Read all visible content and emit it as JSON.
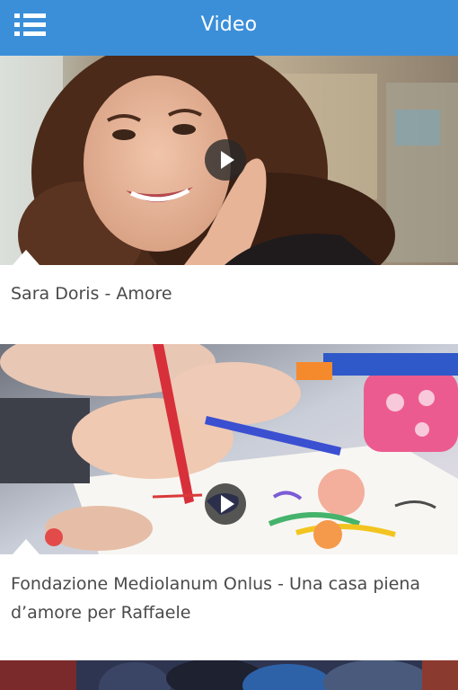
{
  "header": {
    "title": "Video",
    "menu_icon": "menu-icon",
    "background": "#3b8fd9"
  },
  "videos": [
    {
      "title": "Sara Doris - Amore"
    },
    {
      "title": "Fondazione Mediolanum Onlus - Una casa piena d’amore per Raffaele"
    },
    {
      "title": ""
    }
  ]
}
